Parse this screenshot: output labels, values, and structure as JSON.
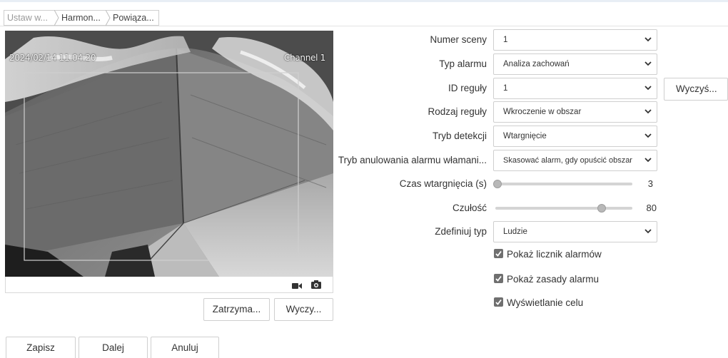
{
  "tabs": [
    {
      "label": "Ustaw w..."
    },
    {
      "label": "Harmon..."
    },
    {
      "label": "Powiąza..."
    }
  ],
  "video": {
    "timestamp": "2024/02/14 11:04:20",
    "channel": "Channel 1"
  },
  "video_controls": {
    "record_icon": "video-camera-icon",
    "snapshot_icon": "camera-icon"
  },
  "video_buttons": {
    "stop": "Zatrzyma...",
    "clear": "Wyczy..."
  },
  "form": {
    "scene_number": {
      "label": "Numer sceny",
      "value": "1"
    },
    "alarm_type": {
      "label": "Typ alarmu",
      "value": "Analiza zachowań"
    },
    "rule_id": {
      "label": "ID reguły",
      "value": "1",
      "clear_button": "Wyczyś..."
    },
    "rule_kind": {
      "label": "Rodzaj reguły",
      "value": "Wkroczenie w obszar"
    },
    "detection_mode": {
      "label": "Tryb detekcji",
      "value": "Wtargnięcie"
    },
    "cancel_mode": {
      "label": "Tryb anulowania alarmu włamani...",
      "value": "Skasować alarm, gdy opuścić obszar"
    },
    "intrusion_time": {
      "label": "Czas wtargnięcia (s)",
      "value": "3",
      "fraction": 0.0
    },
    "sensitivity": {
      "label": "Czułość",
      "value": "80",
      "fraction": 0.8
    },
    "define_type": {
      "label": "Zdefiniuj typ",
      "value": "Ludzie"
    },
    "show_alarm_counter": {
      "label": "Pokaż licznik alarmów",
      "checked": true
    },
    "show_alarm_rules": {
      "label": "Pokaż zasady alarmu",
      "checked": true
    },
    "show_target": {
      "label": "Wyświetlanie celu",
      "checked": true
    }
  },
  "footer": {
    "save": "Zapisz",
    "next": "Dalej",
    "cancel": "Anuluj"
  }
}
